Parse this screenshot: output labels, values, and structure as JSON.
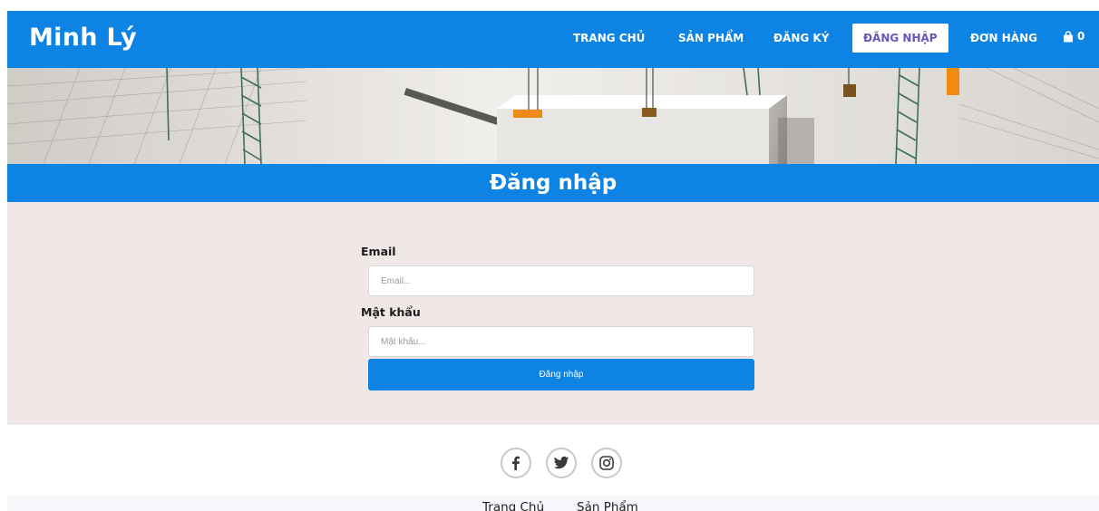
{
  "brand": "Minh Lý",
  "nav": {
    "items": [
      {
        "label": "TRANG CHỦ"
      },
      {
        "label": "SẢN PHẨM"
      },
      {
        "label": "ĐĂNG KÝ"
      },
      {
        "label": "ĐĂNG NHẬP",
        "active": true
      },
      {
        "label": "ĐƠN HÀNG"
      }
    ],
    "cart_icon": "shopping-bag-icon",
    "cart_count": "0"
  },
  "page_title": "Đăng nhập",
  "form": {
    "email_label": "Email",
    "email_placeholder": "Email...",
    "email_value": "",
    "password_label": "Mật khẩu",
    "password_placeholder": "Mật khẩu...",
    "password_value": "",
    "submit_label": "Đăng nhập"
  },
  "social": [
    {
      "icon": "facebook-icon"
    },
    {
      "icon": "twitter-icon"
    },
    {
      "icon": "instagram-icon"
    }
  ],
  "footer": {
    "links": [
      "Trang Chủ",
      "Sản Phẩm"
    ]
  },
  "colors": {
    "primary": "#0d83e4",
    "active_nav_text": "#6a55b8",
    "form_background": "#efe8e6"
  }
}
